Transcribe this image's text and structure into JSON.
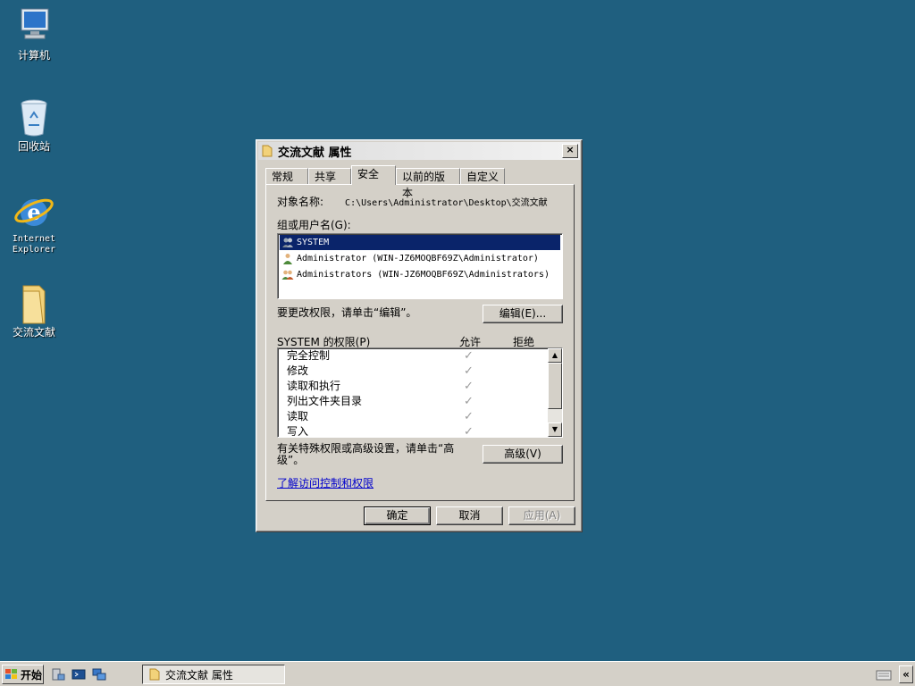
{
  "desktop": {
    "icons": [
      {
        "label": "计算机"
      },
      {
        "label": "回收站"
      },
      {
        "label": "Internet Explorer"
      },
      {
        "label": "交流文献"
      }
    ]
  },
  "dialog": {
    "title": "交流文献 属性",
    "close_label": "×",
    "tabs": [
      {
        "label": "常规"
      },
      {
        "label": "共享"
      },
      {
        "label": "安全"
      },
      {
        "label": "以前的版本"
      },
      {
        "label": "自定义"
      }
    ],
    "active_tab": "安全",
    "object_label": "对象名称:",
    "object_path": "C:\\Users\\Administrator\\Desktop\\交流文献",
    "group_label": "组或用户名(G):",
    "users": [
      {
        "name": "SYSTEM",
        "selected": true
      },
      {
        "name": "Administrator (WIN-JZ6MOQBF69Z\\Administrator)",
        "selected": false
      },
      {
        "name": "Administrators (WIN-JZ6MOQBF69Z\\Administrators)",
        "selected": false
      }
    ],
    "edit_hint": "要更改权限，请单击“编辑”。",
    "edit_button": "编辑(E)...",
    "perm_title": "SYSTEM 的权限(P)",
    "allow_header": "允许",
    "deny_header": "拒绝",
    "permissions": [
      {
        "name": "完全控制",
        "allow": true
      },
      {
        "name": "修改",
        "allow": true
      },
      {
        "name": "读取和执行",
        "allow": true
      },
      {
        "name": "列出文件夹目录",
        "allow": true
      },
      {
        "name": "读取",
        "allow": true
      },
      {
        "name": "写入",
        "allow": true
      }
    ],
    "advanced_hint": "有关特殊权限或高级设置，请单击“高级”。",
    "advanced_button": "高级(V)",
    "learn_link": "了解访问控制和权限",
    "ok_button": "确定",
    "cancel_button": "取消",
    "apply_button": "应用(A)"
  },
  "taskbar": {
    "start_label": "开始",
    "window_button": "交流文献 属性",
    "tray_expand": "«"
  },
  "colors": {
    "desktop": "#1f5f7f",
    "selection": "#0a246a",
    "link": "#0000cc"
  }
}
